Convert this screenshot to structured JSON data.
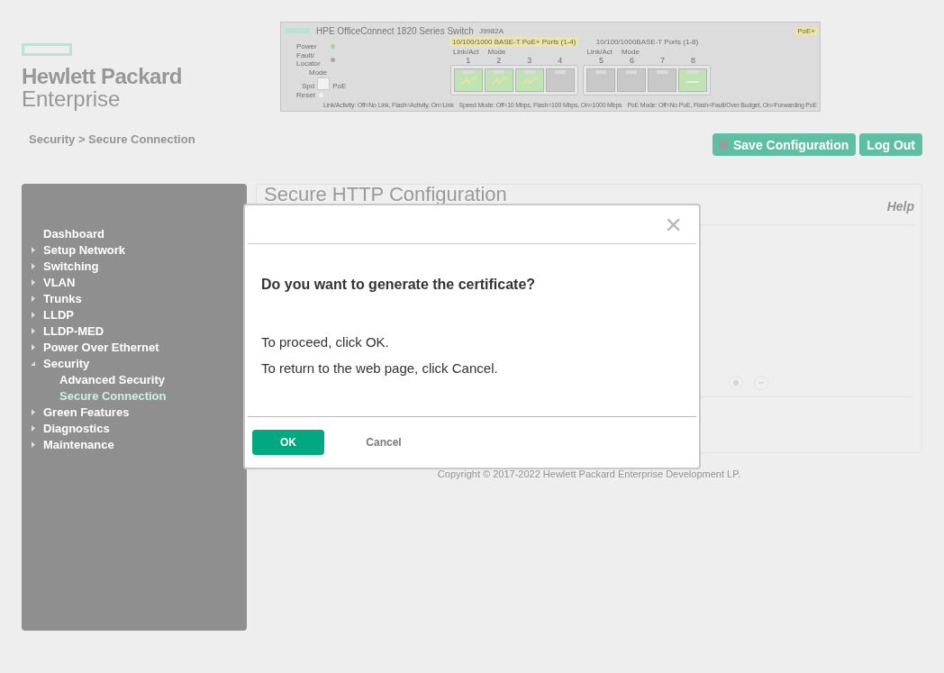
{
  "brand": {
    "line1": "Hewlett Packard",
    "line2": "Enterprise"
  },
  "device": {
    "title": "HPE OfficeConnect 1820 Series Switch",
    "model": "J9982A",
    "badge": "PoE+",
    "leds": [
      {
        "label": "Power",
        "on": true
      },
      {
        "label": "Fault/ Locator",
        "on": false
      }
    ],
    "mode": {
      "label": "Mode",
      "left": "Spd",
      "right": "PoE"
    },
    "reset": "Reset",
    "groups": [
      {
        "label": "10/100/1000 BASE-T PoE+ Ports (1-4)",
        "highlighted": true,
        "link_label": "Link/Act",
        "mode_label": "Mode",
        "ports": [
          {
            "number": "1",
            "kind": "poe"
          },
          {
            "number": "2",
            "kind": "poe"
          },
          {
            "number": "3",
            "kind": "poe"
          },
          {
            "number": "4",
            "kind": "off"
          }
        ]
      },
      {
        "label": "10/100/1000BASE-T Ports (1-8)",
        "highlighted": false,
        "link_label": "Link/Act",
        "mode_label": "Mode",
        "ports": [
          {
            "number": "5",
            "kind": "off"
          },
          {
            "number": "6",
            "kind": "off"
          },
          {
            "number": "7",
            "kind": "off"
          },
          {
            "number": "8",
            "kind": "link"
          }
        ]
      }
    ],
    "legend": [
      "Link/Activity: Off=No Link, Flash=Activity, On=Link",
      "Speed Mode: Off=10 Mbps, Flash=100 Mbps, On=1000 Mbps",
      "PoE Mode: Off=No PoE, Flash=Fault/Over Budget, On=Forwarding PoE"
    ]
  },
  "breadcrumb": "Security > Secure Connection",
  "header_buttons": [
    {
      "label": "Save Configuration",
      "kind": "save"
    },
    {
      "label": "Log Out",
      "kind": "plain"
    }
  ],
  "sidebar": {
    "items": [
      {
        "label": "Dashboard",
        "kind": "link"
      },
      {
        "label": "Setup Network",
        "kind": "folder",
        "expanded": false
      },
      {
        "label": "Switching",
        "kind": "folder",
        "expanded": false
      },
      {
        "label": "VLAN",
        "kind": "folder",
        "expanded": false
      },
      {
        "label": "Trunks",
        "kind": "folder",
        "expanded": false
      },
      {
        "label": "LLDP",
        "kind": "folder",
        "expanded": false
      },
      {
        "label": "LLDP-MED",
        "kind": "folder",
        "expanded": false
      },
      {
        "label": "Power Over Ethernet",
        "kind": "folder",
        "expanded": false
      },
      {
        "label": "Security",
        "kind": "folder",
        "expanded": true,
        "children": [
          {
            "label": "Advanced Security",
            "selected": false
          },
          {
            "label": "Secure Connection",
            "selected": true
          }
        ]
      },
      {
        "label": "Green Features",
        "kind": "folder",
        "expanded": false
      },
      {
        "label": "Diagnostics",
        "kind": "folder",
        "expanded": false
      },
      {
        "label": "Maintenance",
        "kind": "folder",
        "expanded": false
      }
    ]
  },
  "panel": {
    "title": "Secure HTTP Configuration",
    "help": "Help"
  },
  "copyright": "Copyright © 2017-2022 Hewlett Packard Enterprise Development LP.",
  "dialog": {
    "close": "×",
    "question": "Do you want to generate the certificate?",
    "lines": [
      "To proceed, click OK.",
      "To return to the web page, click Cancel."
    ],
    "buttons": [
      {
        "label": "OK",
        "kind": "primary"
      },
      {
        "label": "Cancel",
        "kind": "link"
      }
    ]
  }
}
